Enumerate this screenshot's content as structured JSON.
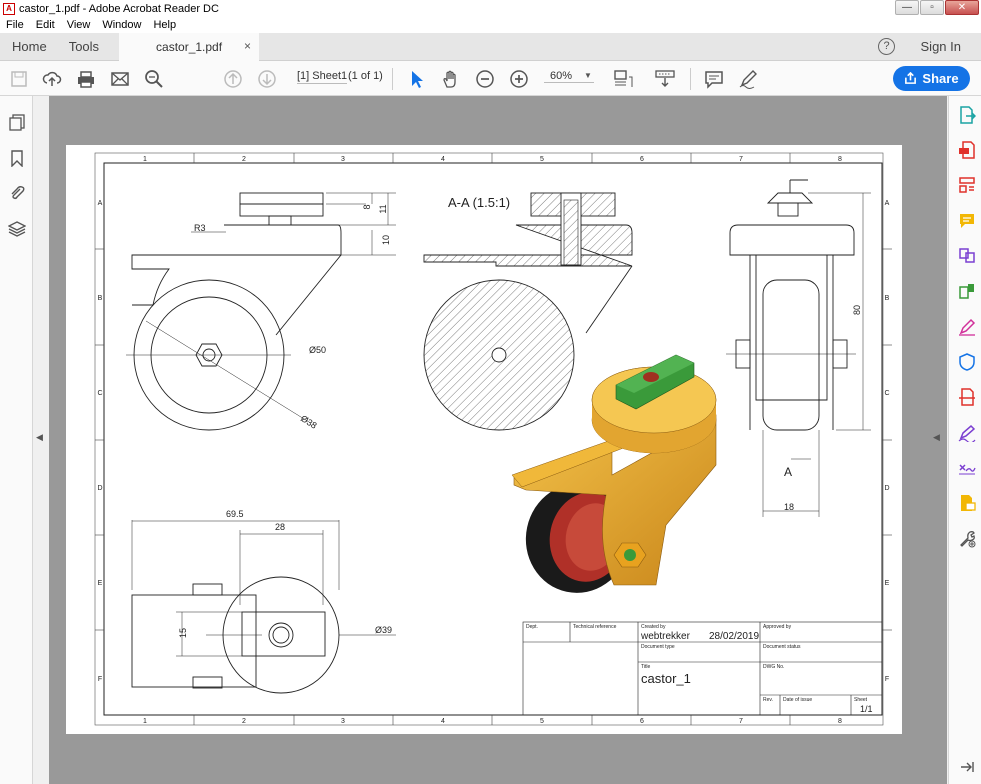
{
  "window": {
    "title": "castor_1.pdf - Adobe Acrobat Reader DC"
  },
  "menu": [
    "File",
    "Edit",
    "View",
    "Window",
    "Help"
  ],
  "tabs": {
    "home": "Home",
    "tools": "Tools",
    "document": "castor_1.pdf",
    "close": "×"
  },
  "header": {
    "help": "?",
    "signin": "Sign In"
  },
  "toolbar": {
    "page_label": "[1] Sheet1",
    "page_count": "(1 of 1)",
    "zoom": "60%",
    "share": "Share"
  },
  "drawing": {
    "section_label": "A-A (1.5:1)",
    "col_labels": [
      "1",
      "2",
      "3",
      "4",
      "5",
      "6",
      "7",
      "8"
    ],
    "row_labels": [
      "A",
      "B",
      "C",
      "D",
      "E",
      "F"
    ],
    "dims": {
      "r3": "R3",
      "d8": "8",
      "d11": "11",
      "d10": "10",
      "d50": "Ø50",
      "d38": "Ø38",
      "d80": "80",
      "dA": "A",
      "d18": "18",
      "d695": "69.5",
      "d28": "28",
      "d15": "15",
      "d39": "Ø39"
    },
    "title_block": {
      "dept": "Dept.",
      "tech_ref": "Technical reference",
      "created_by_lbl": "Created by",
      "approved_by_lbl": "Approved by",
      "created_by": "webtrekker",
      "date": "28/02/2019",
      "doc_type": "Document type",
      "doc_status": "Document status",
      "title_lbl": "Title",
      "dwg_no": "DWG No.",
      "title": "castor_1",
      "rev": "Rev.",
      "date_issue": "Date of issue",
      "sheet_lbl": "Sheet",
      "sheet": "1/1"
    }
  },
  "colors": {
    "accent": "#1473e6",
    "yellow": "#e8a21f",
    "green": "#3a9a3a",
    "tire": "#1a1a1a",
    "rim": "#b03028"
  }
}
